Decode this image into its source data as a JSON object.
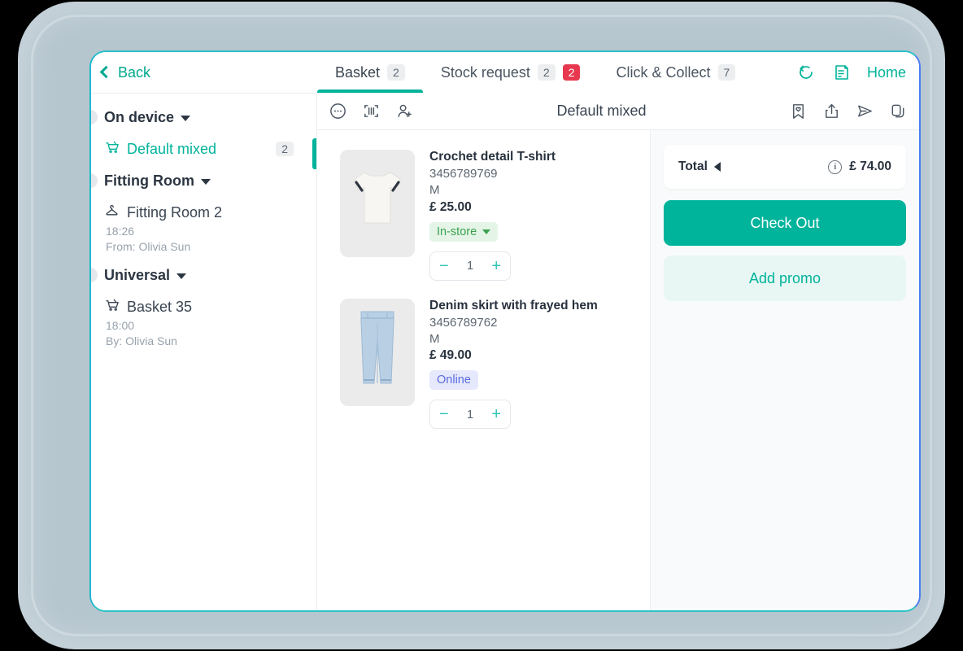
{
  "topbar": {
    "back_label": "Back",
    "home_label": "Home",
    "tabs": [
      {
        "label": "Basket",
        "count": "2",
        "alert": "",
        "active": true
      },
      {
        "label": "Stock request",
        "count": "2",
        "alert": "2",
        "active": false
      },
      {
        "label": "Click & Collect",
        "count": "7",
        "alert": "",
        "active": false
      }
    ],
    "icons": [
      "undo-icon",
      "receipt-icon"
    ]
  },
  "sidebar": {
    "groups": [
      {
        "title": "On device",
        "rows": [
          {
            "icon": "cart-icon",
            "label": "Default mixed",
            "count": "2",
            "time": "",
            "person": "",
            "active": true
          }
        ]
      },
      {
        "title": "Fitting Room",
        "rows": [
          {
            "icon": "hanger-icon",
            "label": "Fitting Room 2",
            "count": "",
            "time": "18:26",
            "person": "From: Olivia Sun",
            "active": false
          }
        ]
      },
      {
        "title": "Universal",
        "rows": [
          {
            "icon": "cart-icon",
            "label": "Basket 35",
            "count": "",
            "time": "18:00",
            "person": "By: Olivia Sun",
            "active": false
          }
        ]
      }
    ]
  },
  "toolbar": {
    "title": "Default mixed",
    "left_icons": [
      "more-options-icon",
      "barcode-scan-icon",
      "add-customer-icon"
    ],
    "right_icons": [
      "wishlist-icon",
      "share-icon",
      "send-icon",
      "duplicate-icon"
    ]
  },
  "cart": {
    "items": [
      {
        "name": "Crochet detail T-shirt",
        "sku": "3456789769",
        "size": "M",
        "price": "£ 25.00",
        "fulfilment": "In-store",
        "fulfilment_type": "instore",
        "fulfilment_has_caret": true,
        "qty": "1",
        "thumb": "tshirt"
      },
      {
        "name": "Denim skirt with frayed hem",
        "sku": "3456789762",
        "size": "M",
        "price": "£ 49.00",
        "fulfilment": "Online",
        "fulfilment_type": "online",
        "fulfilment_has_caret": false,
        "qty": "1",
        "thumb": "jeans"
      }
    ]
  },
  "summary": {
    "total_label": "Total",
    "total_value": "£ 74.00",
    "checkout_label": "Check Out",
    "promo_label": "Add promo"
  },
  "colors": {
    "accent": "#00b39b",
    "danger": "#e8384f",
    "instore_text": "#3aa14e",
    "online_text": "#5b6ce0"
  }
}
